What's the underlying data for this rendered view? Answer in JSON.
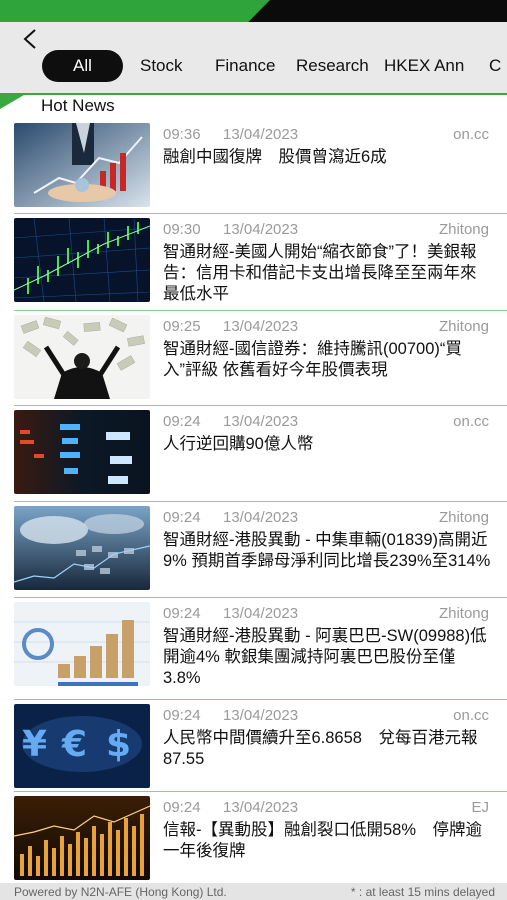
{
  "header": {
    "back_icon": "chevron-left-icon",
    "tabs": [
      {
        "label": "All",
        "active": true
      },
      {
        "label": "Stock",
        "active": false
      },
      {
        "label": "Finance",
        "active": false
      },
      {
        "label": "Research",
        "active": false
      },
      {
        "label": "HKEX Ann",
        "active": false
      },
      {
        "label": "C",
        "active": false
      }
    ]
  },
  "section": {
    "title": "Hot News"
  },
  "colors": {
    "accent_green": "#39a840",
    "active_tab": "#0e0e0e",
    "meta_gray": "#9a9a9a"
  },
  "news": [
    {
      "time": "09:36",
      "date": "13/04/2023",
      "source": "on.cc",
      "title": "融創中國復牌　股價曾瀉近6成",
      "thumb": "hands-growth-chart"
    },
    {
      "time": "09:30",
      "date": "13/04/2023",
      "source": "Zhitong",
      "title": "智通財經-美國人開始“縮衣節食”了！美銀報告：信用卡和借記卡支出增長降至至兩年來最低水平",
      "thumb": "green-candlestick-chart"
    },
    {
      "time": "09:25",
      "date": "13/04/2023",
      "source": "Zhitong",
      "title": "智通財經-國信證券：維持騰訊(00700)“買入”評級 依舊看好今年股價表現",
      "thumb": "businessman-money-rain"
    },
    {
      "time": "09:24",
      "date": "13/04/2023",
      "source": "on.cc",
      "title": "人行逆回購90億人幣",
      "thumb": "stock-ticker-board"
    },
    {
      "time": "09:24",
      "date": "13/04/2023",
      "source": "Zhitong",
      "title": "智通財經-港股異動 - 中集車輛(01839)高開近9% 預期首季歸母淨利同比增長239%至314%",
      "thumb": "sky-numbers-chart"
    },
    {
      "time": "09:24",
      "date": "13/04/2023",
      "source": "Zhitong",
      "title": "智通財經-港股異動 - 阿裏巴巴-SW(09988)低開逾4% 軟銀集團減持阿裏巴巴股份至僅3.8%",
      "thumb": "coins-growth-chart"
    },
    {
      "time": "09:24",
      "date": "13/04/2023",
      "source": "on.cc",
      "title": "人民幣中間價續升至6.8658　兌每百港元報87.55",
      "thumb": "currency-symbols"
    },
    {
      "time": "09:24",
      "date": "13/04/2023",
      "source": "EJ",
      "title": "信報-【異動股】融創裂口低開58%　停牌逾一年後復牌",
      "thumb": "golden-bar-chart"
    }
  ],
  "footer": {
    "left": "Powered by N2N-AFE (Hong Kong) Ltd.",
    "right": "* : at least 15 mins delayed"
  }
}
